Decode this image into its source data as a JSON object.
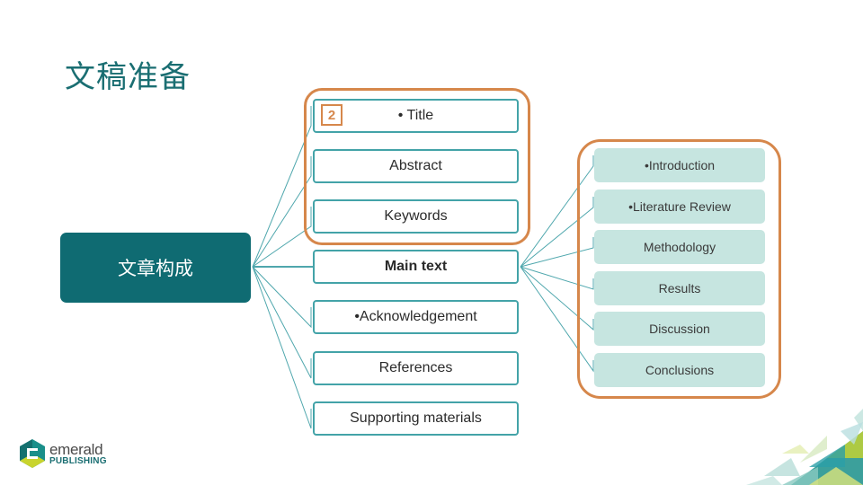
{
  "slide": {
    "title": "文稿准备"
  },
  "diagram": {
    "root": {
      "label": "文章构成"
    },
    "badge": {
      "label": "2"
    },
    "middle_items": [
      {
        "label": "• Title",
        "bold": false,
        "grouped": true
      },
      {
        "label": "Abstract",
        "bold": false,
        "grouped": true
      },
      {
        "label": "Keywords",
        "bold": false,
        "grouped": true
      },
      {
        "label": "Main text",
        "bold": true,
        "grouped": false
      },
      {
        "label": "•Acknowledgement",
        "bold": false,
        "grouped": false
      },
      {
        "label": "References",
        "bold": false,
        "grouped": false
      },
      {
        "label": "Supporting materials",
        "bold": false,
        "grouped": false
      }
    ],
    "main_text_children": [
      {
        "label": "•Introduction"
      },
      {
        "label": "•Literature Review"
      },
      {
        "label": "Methodology"
      },
      {
        "label": "Results"
      },
      {
        "label": "Discussion"
      },
      {
        "label": "Conclusions"
      }
    ]
  },
  "logo": {
    "word": "emerald",
    "sub": "PUBLISHING"
  },
  "colors": {
    "title": "#1a6e72",
    "root_fill": "#0f6b72",
    "box_border": "#43a3a8",
    "group_frame": "#d6874b",
    "child_fill": "#c6e5e0",
    "connector": "#4fa7ad"
  }
}
